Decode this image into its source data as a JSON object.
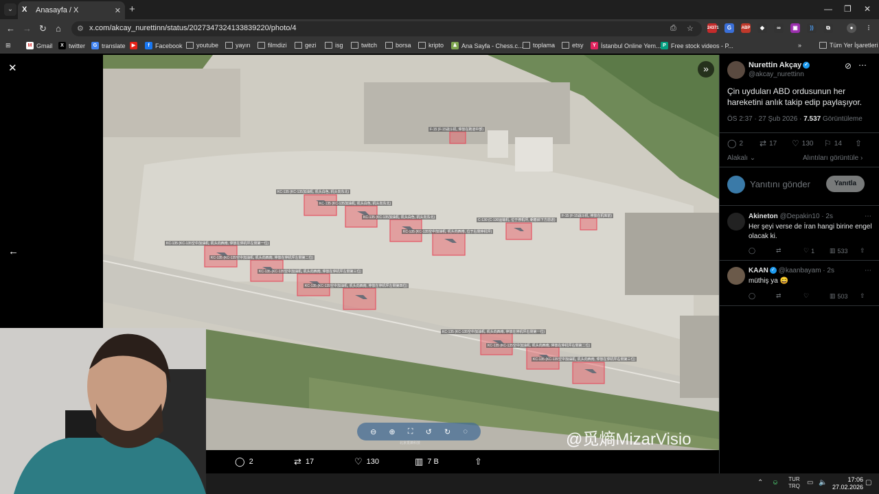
{
  "browser": {
    "tab_title": "Anasayfa / X",
    "tab_favicon": "X",
    "url": "x.com/akcay_nurettinn/status/2027347324133839220/photo/4",
    "extension_badge": "24371",
    "bookmarks": [
      {
        "label": "Gmail",
        "icon": "gmail-icon"
      },
      {
        "label": "twitter",
        "icon": "x-icon"
      },
      {
        "label": "translate",
        "icon": "translate-icon"
      },
      {
        "label": "",
        "icon": "youtube-icon"
      },
      {
        "label": "Facebook",
        "icon": "facebook-icon"
      },
      {
        "label": "youtube",
        "icon": "folder-icon"
      },
      {
        "label": "yayın",
        "icon": "folder-icon"
      },
      {
        "label": "filmdizi",
        "icon": "folder-icon"
      },
      {
        "label": "gezi",
        "icon": "folder-icon"
      },
      {
        "label": "isg",
        "icon": "folder-icon"
      },
      {
        "label": "twitch",
        "icon": "folder-icon"
      },
      {
        "label": "borsa",
        "icon": "folder-icon"
      },
      {
        "label": "kripto",
        "icon": "folder-icon"
      },
      {
        "label": "Ana Sayfa - Chess.c...",
        "icon": "chess-icon"
      },
      {
        "label": "toplama",
        "icon": "folder-icon"
      },
      {
        "label": "etsy",
        "icon": "folder-icon"
      },
      {
        "label": "İstanbul Online Yem...",
        "icon": "yemek-icon"
      },
      {
        "label": "Free stock videos - P...",
        "icon": "pexels-icon"
      }
    ],
    "all_bookmarks": "Tüm Yer İşaretleri"
  },
  "viewer": {
    "watermark": "@觅熵MizarVisio",
    "watermark_small": "北京觅熵科技",
    "annotations": [
      "F-15 (F-15战斗机, 停放在跑道中部)",
      "KC-135 (KC-135加油机, 机头白色, 机头向东北)",
      "KC-135 (KC-135加油机, 机头白色, 机头向东北)",
      "KC-135 (KC-135加油机, 机头白色, 机头向东北)",
      "KC-135 (KC-135空中加油机, 机头向西南, 位于右侧停机坪)",
      "C-130 (C-130运输机, 位于停机坪, 朝着斜下方前进)",
      "F-15 (F-15战斗机, 停放在机库前)",
      "KC-135 (KC-135空中加油机, 机头向西南, 停放在停机坪左侧第一位)",
      "KC-135 (KC-135空中加油机, 机头向西南, 停放在停机坪左侧第二位)",
      "KC-135 (KC-135空中加油机, 机头向西南, 停放在停机坪左侧第三位)",
      "KC-135 (KC-135空中加油机, 机头向西南, 停放在停机坪左侧第四位)",
      "KC-135 (KC-135空中加油机, 机头向西南, 停放在停机坪右侧第一位)",
      "KC-135 (KC-135空中加油机, 机头向西南, 停放在停机坪右侧第二位)",
      "KC-135 (KC-135空中加油机, 机头向西南, 停放在停机坪右侧第三位)"
    ],
    "actions": {
      "replies": "2",
      "reposts": "17",
      "likes": "130",
      "views": "7 B"
    }
  },
  "tweet": {
    "author_name": "Nurettin Akçay",
    "author_handle": "@akcay_nurettinn",
    "text": "Çin uyduları ABD ordusunun her hareketini anlık takip edip paylaşıyor.",
    "time": "ÖS 2:37 · 27 Şub 2026 · ",
    "views_count": "7.537",
    "views_label": " Görüntüleme",
    "stats": {
      "replies": "2",
      "reposts": "17",
      "likes": "130",
      "bookmarks": "14"
    },
    "sort_label": "Alakalı",
    "quotes_link": "Alıntıları görüntüle",
    "reply_placeholder": "Yanıtını gönder",
    "reply_button": "Yanıtla"
  },
  "replies": [
    {
      "name": "Akineton",
      "handle": "@Depakin10 · 2s",
      "text": "Her şeyi verse de İran hangi birine engel olacak ki.",
      "likes": "1",
      "views": "533"
    },
    {
      "name": "KAAN",
      "handle": "@kaanbayam · 2s",
      "text": "müthiş ya 😄",
      "likes": "",
      "views": "503"
    }
  ],
  "taskbar": {
    "lang_top": "TUR",
    "lang_bottom": "TRQ",
    "time": "17:06",
    "date": "27.02.2026"
  }
}
